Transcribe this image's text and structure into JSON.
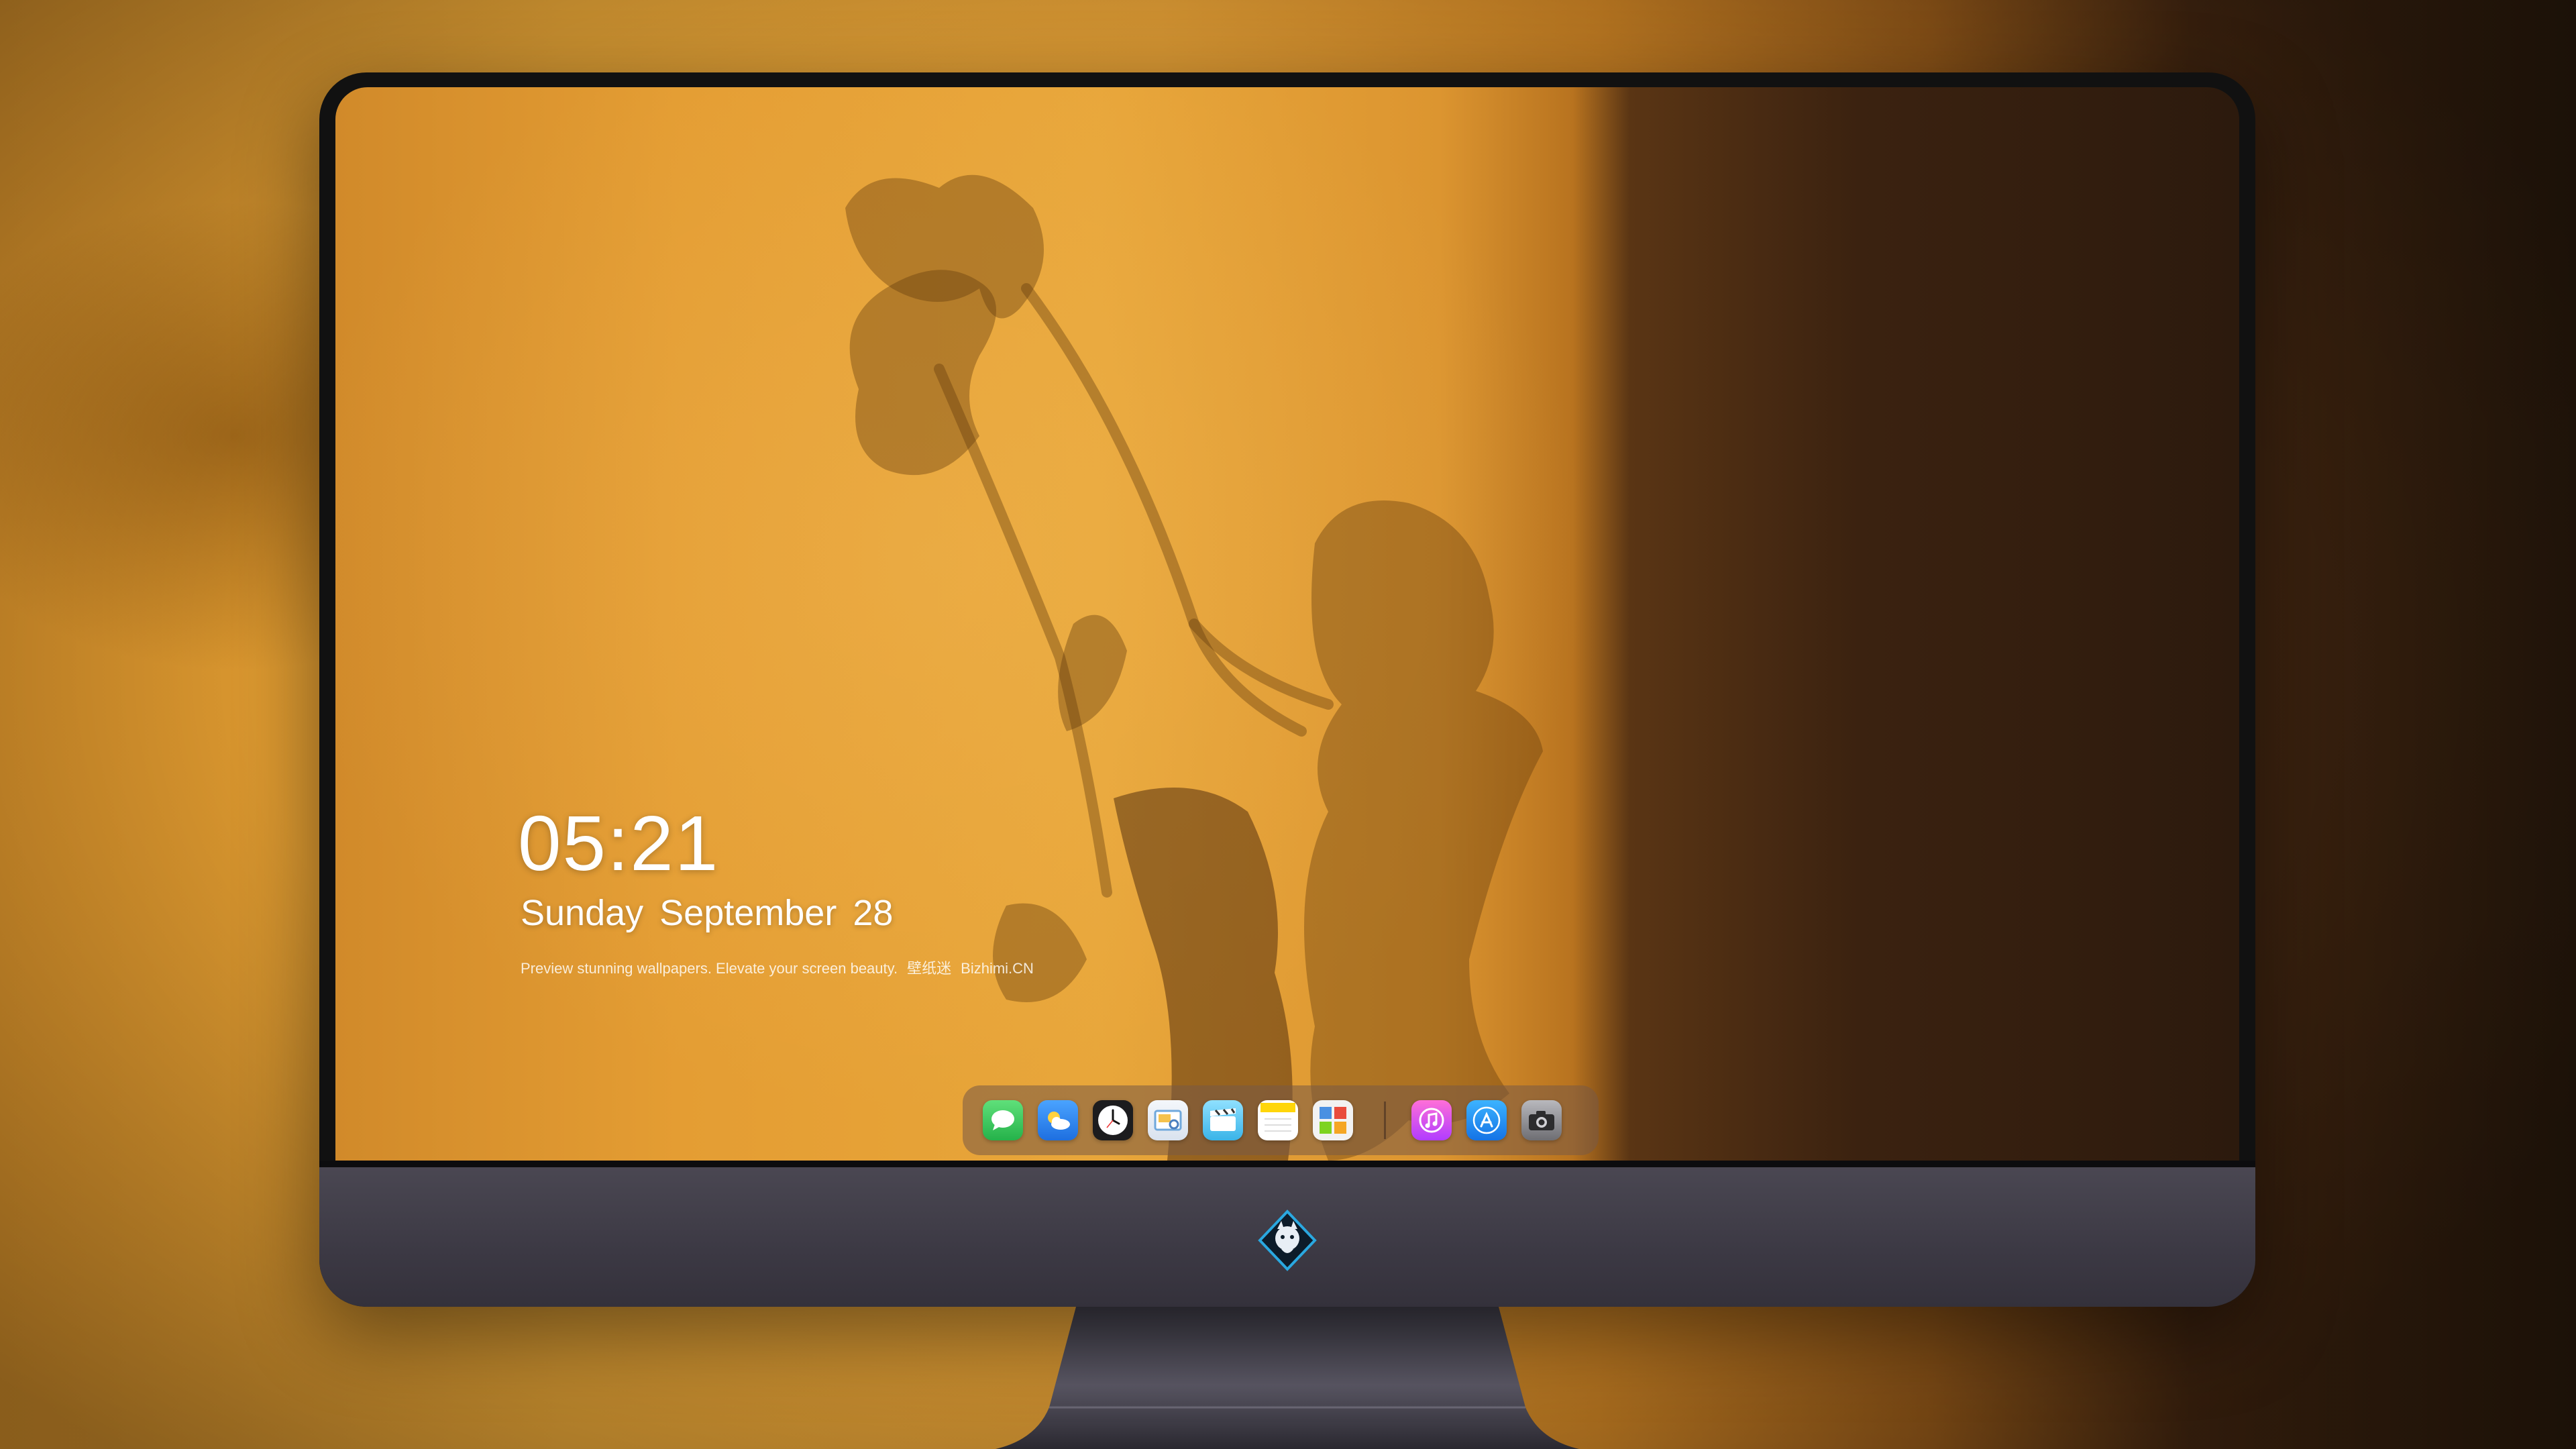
{
  "lockscreen": {
    "time": "05:21",
    "date_weekday": "Sunday",
    "date_month": "September",
    "date_day": "28",
    "tagline_text": "Preview stunning wallpapers. Elevate your screen beauty.",
    "tagline_cn": "壁纸迷",
    "tagline_site": "Bizhimi.CN"
  },
  "dock": {
    "icons": [
      {
        "name": "messages-icon",
        "color": "#34c759"
      },
      {
        "name": "weather-icon",
        "color": "#3a8ef0"
      },
      {
        "name": "clock-icon",
        "color": "#1c1c1e"
      },
      {
        "name": "preview-icon",
        "color": "#e9eef5"
      },
      {
        "name": "clips-icon",
        "color": "#5ac8fa"
      },
      {
        "name": "notes-icon",
        "color": "#ffd60a"
      },
      {
        "name": "photo-booth-icon",
        "color": "#f2f2f2"
      },
      {
        "name": "itunes-icon",
        "color": "#e84dc7"
      },
      {
        "name": "app-store-icon",
        "color": "#1a8cff"
      },
      {
        "name": "camera-icon",
        "color": "#8e8e93"
      }
    ]
  },
  "colors": {
    "wall_orange": "#e49d33",
    "bezel_gray": "#3c3944"
  }
}
